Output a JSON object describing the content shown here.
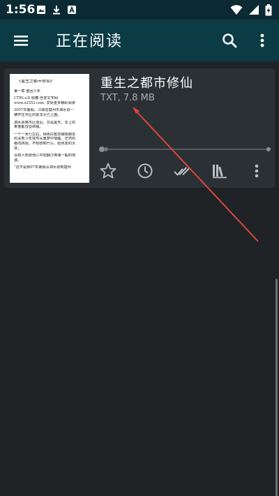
{
  "status_bar": {
    "time": "1:56"
  },
  "app_bar": {
    "title": "正在阅读"
  },
  "book": {
    "title": "重生之都市修仙",
    "meta": "TXT, 7.8 MB",
    "progress": 0,
    "cover_lines": [
      "《重生之都市修仙》",
      "第一章 重回少年",
      "CTRL+D        收藏:吾爱文学网",
      "www.x2552.com, 享受更多精彩阅读",
      "2007年暑假，江南省楚州市泗水县一",
      "辆开往市区的金龙大巴上面。",
      "泗水县离市区很近，又是夏天，车上的",
      "乘客都昏昏欲睡。",
      "一个一米七左右，相色白皙容貌俊朗发",
      "的清秀少年突然从噩梦中惊醒，茫然的",
      "看向四周，不知想到什么，脸色变的大",
      "变。",
      "没有人知道他心中如翻江倒海一般的惊",
      "骇。",
      "“这不是我07年暑假从泗水县到楚州"
    ]
  },
  "icons": {
    "status_left": [
      "image-icon",
      "download-icon",
      "app-a-icon"
    ],
    "status_right": [
      "wifi-icon",
      "signal-icon",
      "battery-charging-icon"
    ],
    "actions": [
      "star-icon",
      "history-clock-icon",
      "mark-read-icon",
      "library-icon",
      "more-vert-icon"
    ]
  },
  "colors": {
    "app_bar": "#0b3b45",
    "status_bar": "#0b2a33",
    "background": "#1f2326",
    "card": "#2b3034",
    "annotation_arrow": "#e0453f"
  }
}
